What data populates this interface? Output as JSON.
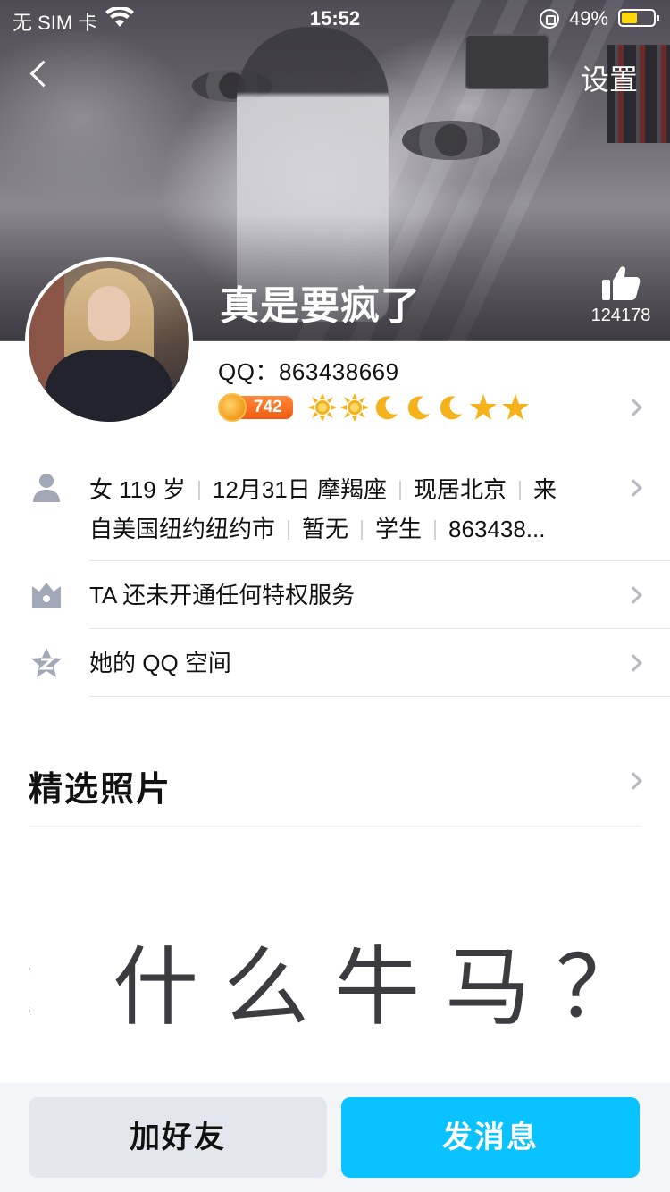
{
  "status_bar": {
    "carrier": "无 SIM 卡",
    "time": "15:52",
    "battery_percent": "49%",
    "battery_level": 0.49,
    "battery_color": "#ffd60a"
  },
  "nav": {
    "back_icon": "chevron-left-icon",
    "settings_label": "设置"
  },
  "profile": {
    "name": "真是要疯了",
    "like_count": "124178",
    "qq_label": "QQ：863438669",
    "vip_level": "742",
    "level_icons": [
      "sun",
      "sun",
      "moon",
      "moon",
      "moon",
      "star",
      "star"
    ]
  },
  "info": {
    "basic_line1": [
      "女 119 岁",
      "12月31日 摩羯座",
      "现居北京",
      "来"
    ],
    "basic_line2": [
      "自美国纽约纽约市",
      "暂无",
      "学生",
      "863438..."
    ],
    "privilege": "TA 还未开通任何特权服务",
    "qzone": "她的 QQ 空间"
  },
  "photos": {
    "title": "精选照片",
    "preview_text": "：什么牛马？恶"
  },
  "actions": {
    "add_friend": "加好友",
    "send_message": "发消息"
  },
  "colors": {
    "accent": "#0ac2ff",
    "vip_orange": "#f05a12",
    "secondary_button": "#e4e6ed"
  }
}
